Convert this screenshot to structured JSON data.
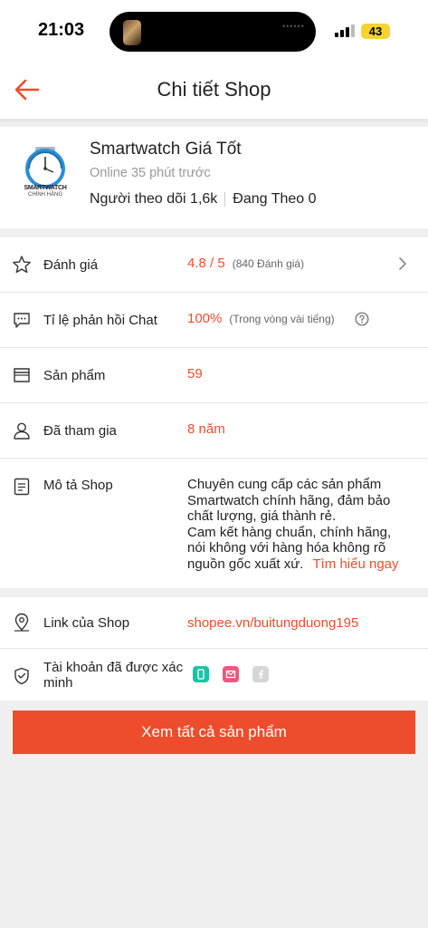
{
  "status_bar": {
    "time": "21:03",
    "battery": "43"
  },
  "header": {
    "title": "Chi tiết Shop"
  },
  "shop": {
    "name": "Smartwatch Giá Tốt",
    "online": "Online 35 phút trước",
    "followers_label": "Người theo dõi 1,6k",
    "following_label": "Đang Theo 0",
    "logo_text_top": "SMARTWATCH",
    "logo_text_bottom": "CHÍNH HÃNG"
  },
  "rows": {
    "rating": {
      "label": "Đánh giá",
      "value": "4.8 / 5",
      "sub": "(840 Đánh giá)"
    },
    "chat": {
      "label": "Tỉ lệ phản hồi Chat",
      "value": "100%",
      "sub": "(Trong vòng vài tiếng)"
    },
    "products": {
      "label": "Sản phẩm",
      "value": "59"
    },
    "joined": {
      "label": "Đã tham gia",
      "value": "8 năm"
    },
    "description": {
      "label": "Mô tả Shop",
      "line1": "Chuyên cung cấp các sản phẩm",
      "line2": "Smartwatch chính hãng, đảm bảo",
      "line3": "chất lượng, giá thành rẻ.",
      "line4": "Cam kết hàng chuẩn, chính hãng,",
      "line5": "nói không với hàng hóa không rõ",
      "line6": "nguồn gốc xuất xứ.",
      "link": "Tìm hiểu ngay"
    },
    "shop_link": {
      "label": "Link của Shop",
      "value": "shopee.vn/buitungduong195"
    },
    "verified": {
      "label_line1": "Tài khoản đã được xác",
      "label_line2": "minh"
    }
  },
  "cta": {
    "label": "Xem tất cả sản phẩm"
  },
  "colors": {
    "accent": "#ee4d2d",
    "phone": "#1cc2a6",
    "email": "#f2557f",
    "facebook": "#d6d6d6"
  }
}
